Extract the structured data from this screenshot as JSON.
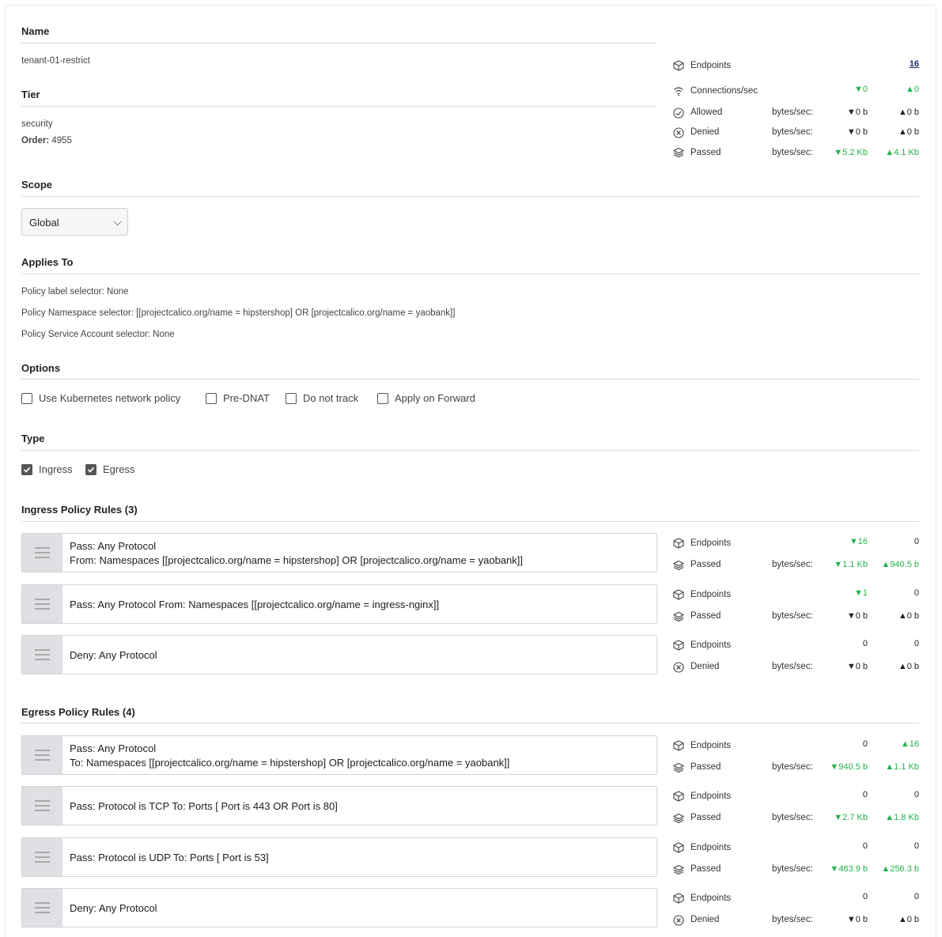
{
  "name": {
    "heading": "Name",
    "value": "tenant-01-restrict"
  },
  "tier": {
    "heading": "Tier",
    "value": "security",
    "order_label": "Order:",
    "order_value": "4955"
  },
  "summary_stats": {
    "endpoints": {
      "label": "Endpoints",
      "value": "16"
    },
    "connections": {
      "label": "Connections/sec",
      "in": "▼0",
      "out": "▲0"
    },
    "allowed": {
      "label": "Allowed",
      "bytes": "bytes/sec:",
      "in": "▼0 b",
      "out": "▲0 b"
    },
    "denied": {
      "label": "Denied",
      "bytes": "bytes/sec:",
      "in": "▼0 b",
      "out": "▲0 b"
    },
    "passed": {
      "label": "Passed",
      "bytes": "bytes/sec:",
      "in": "▼5.2 Kb",
      "out": "▲4.1 Kb"
    }
  },
  "scope": {
    "heading": "Scope",
    "selected": "Global"
  },
  "applies_to": {
    "heading": "Applies To",
    "lines": [
      "Policy label selector: None",
      "Policy Namespace selector: [[projectcalico.org/name = hipstershop] OR [projectcalico.org/name = yaobank]]",
      "Policy Service Account selector: None"
    ]
  },
  "options": {
    "heading": "Options",
    "items": [
      {
        "label": "Use Kubernetes network policy",
        "checked": false
      },
      {
        "label": "Pre-DNAT",
        "checked": false
      },
      {
        "label": "Do not track",
        "checked": false
      },
      {
        "label": "Apply on Forward",
        "checked": false
      }
    ]
  },
  "type": {
    "heading": "Type",
    "items": [
      {
        "label": "Ingress",
        "checked": true
      },
      {
        "label": "Egress",
        "checked": true
      }
    ]
  },
  "ingress": {
    "heading": "Ingress Policy Rules (3)",
    "rules": [
      {
        "line1": "Pass:  Any Protocol",
        "line2": "From:  Namespaces [[projectcalico.org/name = hipstershop] OR [projectcalico.org/name = yaobank]]",
        "stats": {
          "endpoints_label": "Endpoints",
          "ep_in": "▼16",
          "ep_out": "0",
          "action_label": "Passed",
          "action_icon": "layers-icon",
          "bytes": "bytes/sec:",
          "b_in": "▼1.1 Kb",
          "b_out": "▲940.5 b"
        }
      },
      {
        "line1": "Pass:  Any Protocol   From:  Namespaces [[projectcalico.org/name = ingress-nginx]]",
        "line2": "",
        "stats": {
          "endpoints_label": "Endpoints",
          "ep_in": "▼1",
          "ep_out": "0",
          "action_label": "Passed",
          "action_icon": "layers-icon",
          "bytes": "bytes/sec:",
          "b_in": "▼0 b",
          "b_out": "▲0 b"
        }
      },
      {
        "line1": "Deny:  Any Protocol",
        "line2": "",
        "stats": {
          "endpoints_label": "Endpoints",
          "ep_in": "0",
          "ep_out": "0",
          "action_label": "Denied",
          "action_icon": "x-circle-icon",
          "bytes": "bytes/sec:",
          "b_in": "▼0 b",
          "b_out": "▲0 b"
        }
      }
    ]
  },
  "egress": {
    "heading": "Egress Policy Rules (4)",
    "rules": [
      {
        "line1": "Pass:  Any Protocol",
        "line2": "To:  Namespaces [[projectcalico.org/name = hipstershop] OR [projectcalico.org/name = yaobank]]",
        "stats": {
          "endpoints_label": "Endpoints",
          "ep_in": "0",
          "ep_out": "▲16",
          "action_label": "Passed",
          "action_icon": "layers-icon",
          "bytes": "bytes/sec:",
          "b_in": "▼940.5 b",
          "b_out": "▲1.1 Kb"
        }
      },
      {
        "line1": "Pass:  Protocol is TCP   To:  Ports [ Port is 443 OR Port is 80]",
        "line2": "",
        "stats": {
          "endpoints_label": "Endpoints",
          "ep_in": "0",
          "ep_out": "0",
          "action_label": "Passed",
          "action_icon": "layers-icon",
          "bytes": "bytes/sec:",
          "b_in": "▼2.7 Kb",
          "b_out": "▲1.8 Kb"
        }
      },
      {
        "line1": "Pass:  Protocol is UDP   To:  Ports [ Port is 53]",
        "line2": "",
        "stats": {
          "endpoints_label": "Endpoints",
          "ep_in": "0",
          "ep_out": "0",
          "action_label": "Passed",
          "action_icon": "layers-icon",
          "bytes": "bytes/sec:",
          "b_in": "▼483.9 b",
          "b_out": "▲256.3 b"
        }
      },
      {
        "line1": "Deny:  Any Protocol",
        "line2": "",
        "stats": {
          "endpoints_label": "Endpoints",
          "ep_in": "0",
          "ep_out": "0",
          "action_label": "Denied",
          "action_icon": "x-circle-icon",
          "bytes": "bytes/sec:",
          "b_in": "▼0 b",
          "b_out": "▲0 b"
        }
      }
    ]
  },
  "colors": {
    "green": "#22b24c",
    "link": "#1f2d6a"
  }
}
